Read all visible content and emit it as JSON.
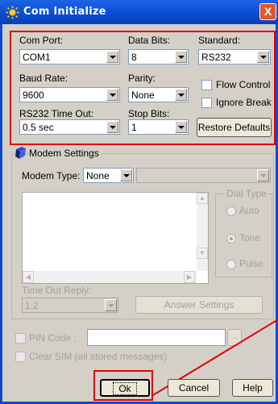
{
  "window": {
    "title": "Com Initialize",
    "close_label": "X"
  },
  "serial": {
    "com_port_label": "Com Port:",
    "com_port_value": "COM1",
    "data_bits_label": "Data Bits:",
    "data_bits_value": "8",
    "standard_label": "Standard:",
    "standard_value": "RS232",
    "baud_rate_label": "Baud Rate:",
    "baud_rate_value": "9600",
    "parity_label": "Parity:",
    "parity_value": "None",
    "flow_control_label": "Flow Control",
    "ignore_break_label": "Ignore Break",
    "timeout_label": "RS232 Time Out:",
    "timeout_value": "0.5 sec",
    "stop_bits_label": "Stop Bits:",
    "stop_bits_value": "1",
    "restore_defaults_label": "Restore Defaults"
  },
  "modem": {
    "group_label": "Modem Settings",
    "modem_type_label": "Modem Type:",
    "modem_type_value": "None",
    "dial_type_label": "Dial Type",
    "dial_options": [
      "Auto",
      "Tone",
      "Pulse"
    ],
    "dial_selected": "Tone",
    "timeout_reply_label": "Time Out Reply:",
    "timeout_reply_value": "1.2",
    "answer_settings_label": "Answer Settings"
  },
  "pin": {
    "pin_label": "PIN Code :",
    "browse_label": "...",
    "clear_sim_label": "Clear SIM (all stored messages)"
  },
  "buttons": {
    "ok": "Ok",
    "cancel": "Cancel",
    "help": "Help"
  },
  "colors": {
    "highlight": "#e00000",
    "titlebar": "#0a4bd0"
  }
}
